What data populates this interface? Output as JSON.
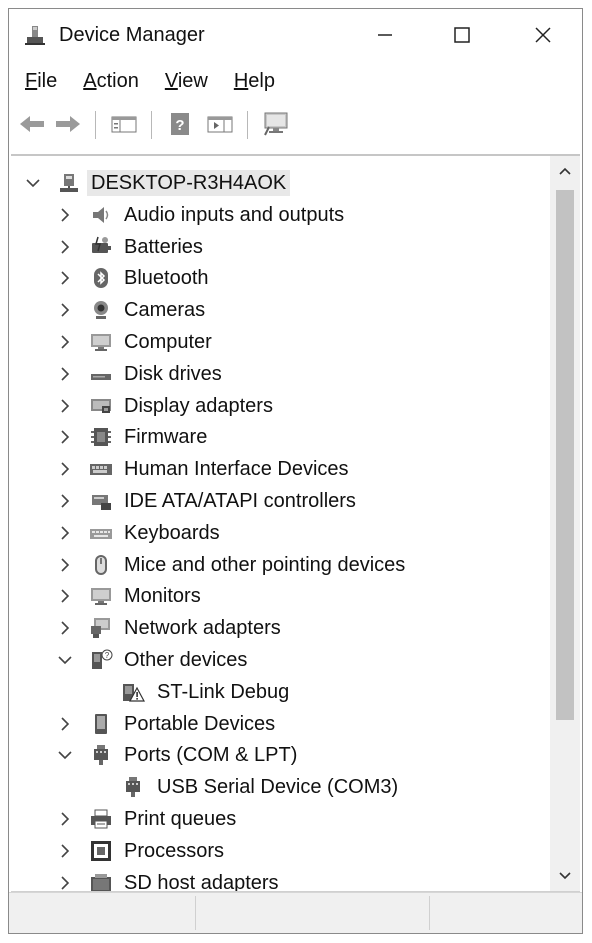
{
  "window": {
    "title": "Device Manager"
  },
  "menu": [
    {
      "label": "File",
      "mnemonic": "F",
      "rest": "ile"
    },
    {
      "label": "Action",
      "mnemonic": "A",
      "rest": "ction"
    },
    {
      "label": "View",
      "mnemonic": "V",
      "rest": "iew"
    },
    {
      "label": "Help",
      "mnemonic": "H",
      "rest": "elp"
    }
  ],
  "toolbar": [
    "back-icon",
    "forward-icon",
    "show-hide-console-tree-icon",
    "help-icon",
    "show-action-pane-icon",
    "scan-hardware-icon"
  ],
  "tree": {
    "root": {
      "label": "DESKTOP-R3H4AOK",
      "expanded": true,
      "icon": "computer-network-icon"
    },
    "items": [
      {
        "label": "Audio inputs and outputs",
        "icon": "speaker-icon",
        "expanded": false,
        "children": []
      },
      {
        "label": "Batteries",
        "icon": "battery-icon",
        "expanded": false,
        "children": []
      },
      {
        "label": "Bluetooth",
        "icon": "bluetooth-icon",
        "expanded": false,
        "children": []
      },
      {
        "label": "Cameras",
        "icon": "camera-icon",
        "expanded": false,
        "children": []
      },
      {
        "label": "Computer",
        "icon": "monitor-icon",
        "expanded": false,
        "children": []
      },
      {
        "label": "Disk drives",
        "icon": "disk-drive-icon",
        "expanded": false,
        "children": []
      },
      {
        "label": "Display adapters",
        "icon": "display-adapter-icon",
        "expanded": false,
        "children": []
      },
      {
        "label": "Firmware",
        "icon": "chip-icon",
        "expanded": false,
        "children": []
      },
      {
        "label": "Human Interface Devices",
        "icon": "hid-icon",
        "expanded": false,
        "children": []
      },
      {
        "label": "IDE ATA/ATAPI controllers",
        "icon": "ide-controller-icon",
        "expanded": false,
        "children": []
      },
      {
        "label": "Keyboards",
        "icon": "keyboard-icon",
        "expanded": false,
        "children": []
      },
      {
        "label": "Mice and other pointing devices",
        "icon": "mouse-icon",
        "expanded": false,
        "children": []
      },
      {
        "label": "Monitors",
        "icon": "monitor-icon",
        "expanded": false,
        "children": []
      },
      {
        "label": "Network adapters",
        "icon": "network-adapter-icon",
        "expanded": false,
        "children": []
      },
      {
        "label": "Other devices",
        "icon": "unknown-device-icon",
        "expanded": true,
        "children": [
          {
            "label": "ST-Link Debug",
            "icon": "warning-device-icon"
          }
        ]
      },
      {
        "label": "Portable Devices",
        "icon": "portable-device-icon",
        "expanded": false,
        "children": []
      },
      {
        "label": "Ports (COM & LPT)",
        "icon": "port-icon",
        "expanded": true,
        "children": [
          {
            "label": "USB Serial Device (COM3)",
            "icon": "port-icon"
          }
        ]
      },
      {
        "label": "Print queues",
        "icon": "printer-icon",
        "expanded": false,
        "children": []
      },
      {
        "label": "Processors",
        "icon": "processor-icon",
        "expanded": false,
        "children": []
      },
      {
        "label": "SD host adapters",
        "icon": "sd-adapter-icon",
        "expanded": false,
        "children": []
      }
    ]
  }
}
